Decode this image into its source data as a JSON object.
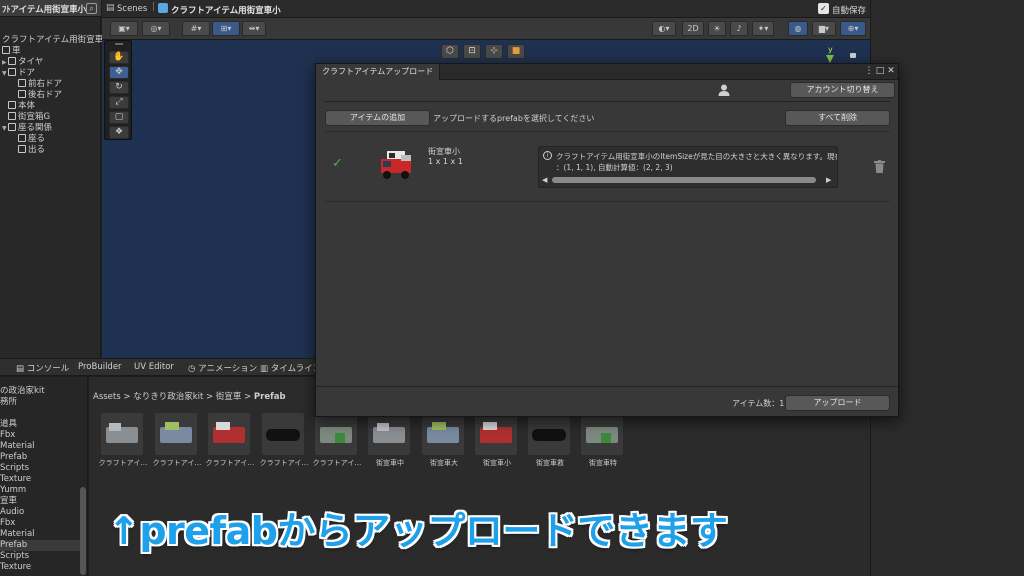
{
  "hierarchy": {
    "title": "ﾌﾄアイテム用街宣車小",
    "nodes": [
      "クラフトアイテム用街宣車小",
      "車",
      "タイヤ",
      "ドア",
      "前右ドア",
      "後右ドア",
      "本体",
      "街宣箱G",
      "座る関係",
      "座る",
      "出る"
    ]
  },
  "scene": {
    "breadcrumb_root": "Scenes",
    "breadcrumb_current": "クラフトアイテム用街宣車小",
    "toolbar_2d": "2D",
    "autosave_label": "自動保存"
  },
  "dialog": {
    "tab_title": "クラフトアイテムアップロード",
    "account_switch_label": "アカウント切り替え",
    "add_item_label": "アイテムの追加",
    "select_hint": "アップロードするprefabを選択してください",
    "delete_all_label": "すべて削除",
    "item": {
      "name": "街宣車小",
      "size": "1 x 1 x 1",
      "warning_line1": "クラフトアイテム用街宣車小のItemSizeが見た目の大きさと大きく異なります。現在",
      "warning_line2": "：(1, 1, 1), 自動計算値：(2, 2, 3)"
    },
    "item_count_label": "アイテム数：1",
    "upload_label": "アップロード"
  },
  "bottom_tabs": [
    "コンソール",
    "ProBuilder",
    "UV Editor",
    "アニメーション",
    "タイムライン"
  ],
  "project_tree": [
    "の政治家kit",
    "務所",
    "",
    "道具",
    "Fbx",
    "Material",
    "Prefab",
    "Scripts",
    "Texture",
    "Yumm",
    "宣車",
    "Audio",
    "Fbx",
    "Material",
    "Prefab",
    "Scripts",
    "Texture"
  ],
  "asset_breadcrumb": {
    "parts": [
      "Assets",
      "なりきり政治家kit",
      "街宣車"
    ],
    "current": "Prefab"
  },
  "assets": [
    "クラフトアイ…",
    "クラフトアイ…",
    "クラフトアイ…",
    "クラフトアイ…",
    "クラフトアイ…",
    "街宣車中",
    "街宣車大",
    "街宣車小",
    "街宣車救",
    "街宣車特"
  ],
  "caption": "↑prefabからアップロードできます",
  "colors": {
    "scene_bg": "#1f3150",
    "accent_blue": "#3e5f96",
    "check_green": "#4caf50",
    "caption_blue": "#1ea0ea"
  }
}
